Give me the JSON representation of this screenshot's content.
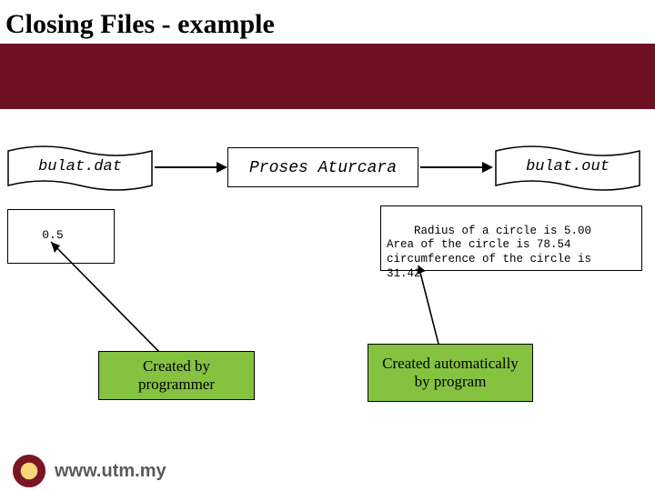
{
  "slide": {
    "title": "Closing Files - example"
  },
  "files": {
    "input_name": "bulat.dat",
    "output_name": "bulat.out",
    "process_label": "Proses Aturcara"
  },
  "input_box": {
    "content": "0.5"
  },
  "output_box": {
    "content": "Radius of a circle is 5.00\nArea of the circle is 78.54\ncircumference of the circle is\n31.42"
  },
  "labels": {
    "left": "Created by programmer",
    "right": "Created automatically by program"
  },
  "footer": {
    "url": "www.utm.my"
  },
  "colors": {
    "maroon": "#6d1021",
    "green": "#84c240"
  }
}
